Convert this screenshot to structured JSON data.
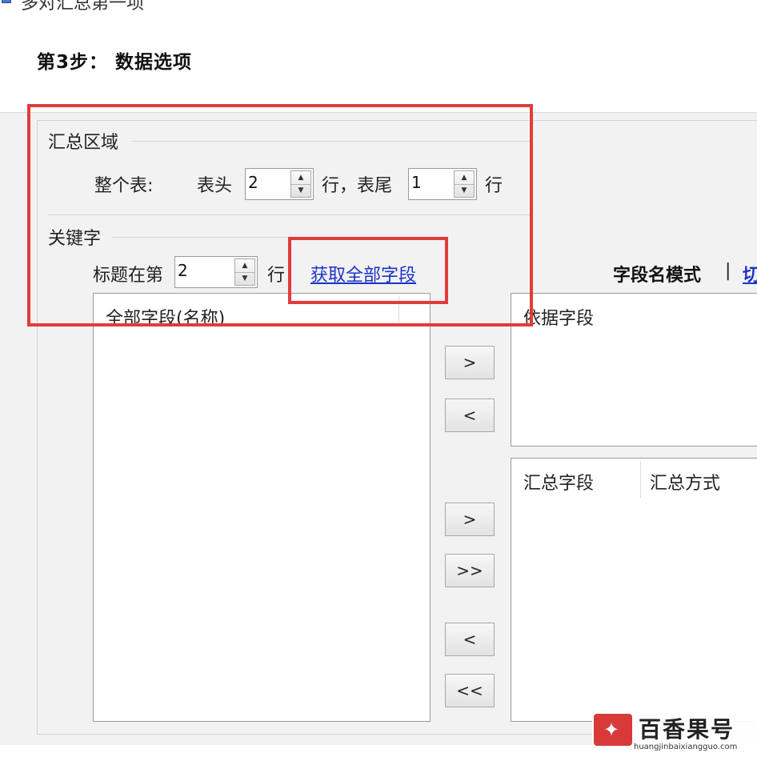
{
  "window": {
    "title_partial": "多对汇总第一项"
  },
  "step": {
    "title": "第3步： 数据选项"
  },
  "summary_area": {
    "group_label": "汇总区域",
    "whole_table_label": "整个表:",
    "header_label": "表头",
    "header_rows": "2",
    "row_comma_label": "行，表尾",
    "footer_rows": "1",
    "row_label": "行"
  },
  "keyword": {
    "group_label": "关键字",
    "title_at_label": "标题在第",
    "title_row": "2",
    "row_label": "行",
    "get_all_fields_link": "获取全部字段"
  },
  "field_name_mode": {
    "label": "字段名模式",
    "separator": "|",
    "cut_text": "切"
  },
  "all_fields_list": {
    "header": "全部字段(名称)"
  },
  "basis_fields_list": {
    "header": "依据字段"
  },
  "summary_fields_list": {
    "header_field": "汇总字段",
    "header_method": "汇总方式"
  },
  "buttons": {
    "add_basis": ">",
    "remove_basis": "<",
    "add_summary": ">",
    "add_all_summary": ">>",
    "remove_summary": "<",
    "remove_all_summary": "<<"
  },
  "watermark": {
    "title": "百香果号",
    "url": "huangjinbaixiangguo.com"
  },
  "colors": {
    "highlight": "#e23b3b",
    "link": "#1a33c8",
    "panel": "#f2f2f2"
  },
  "icons": {
    "app": "app-icon",
    "spin_up": "arrow-up-icon",
    "spin_down": "arrow-down-icon",
    "watermark_logo": "star-logo-icon"
  }
}
